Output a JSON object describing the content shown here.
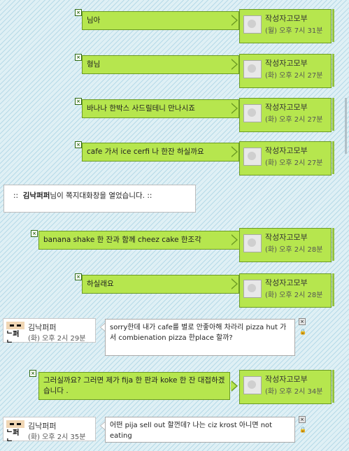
{
  "me": {
    "name": "작성자고모부"
  },
  "messages": [
    {
      "type": "sent",
      "text": "님아",
      "time": "(월) 오후 7시 31분"
    },
    {
      "type": "sent",
      "text": "형님",
      "time": "(화) 오후 2시 27분"
    },
    {
      "type": "sent",
      "text": "바나나 한박스 사드릴테니 만나시죠",
      "time": "(화) 오후 2시 27분"
    },
    {
      "type": "sent",
      "text": "cafe 가서 ice cerfi 나 한잔 하실까요",
      "time": "(화) 오후 2시 27분"
    },
    {
      "type": "notice",
      "prefix": "::",
      "name": "김낙퍼퍼",
      "text": "님이 쪽지대화창을 열었습니다.",
      "suffix": "::"
    },
    {
      "type": "sent",
      "text": "banana shake 한 잔과 함께 cheez cake 한조각",
      "time": "(화) 오후 2시 28분"
    },
    {
      "type": "sent",
      "text": "하실래요",
      "time": "(화) 오후 2시 28분"
    },
    {
      "type": "received",
      "name": "김낙퍼퍼",
      "avatar_label": "ᄂ퍼ᄂ",
      "text": "sorry한데 내가 cafe를 별로 안좋아해 차라리 pizza hut 가서 combienation pizza 한place 할까?",
      "time": "(화) 오후 2시 29분"
    },
    {
      "type": "sent",
      "text": "그러실까요? 그러면 제가 fija 한 판과 koke 한 잔 대접하겠습니다 .",
      "time": "(화) 오후 2시 34분"
    },
    {
      "type": "received",
      "name": "김낙퍼퍼",
      "avatar_label": "ᄂ퍼ᄂ",
      "text": "어떤 pija sell out 할껀데? 나는 ciz krost 아니면 not eating",
      "time": "(화) 오후 2시 35분"
    }
  ],
  "icons": {
    "delete": "close-x-icon",
    "lock": "lock-icon"
  },
  "colors": {
    "sent_bubble": "#b6e64e",
    "sent_border": "#6b9a23",
    "background": "#dff0f5"
  }
}
